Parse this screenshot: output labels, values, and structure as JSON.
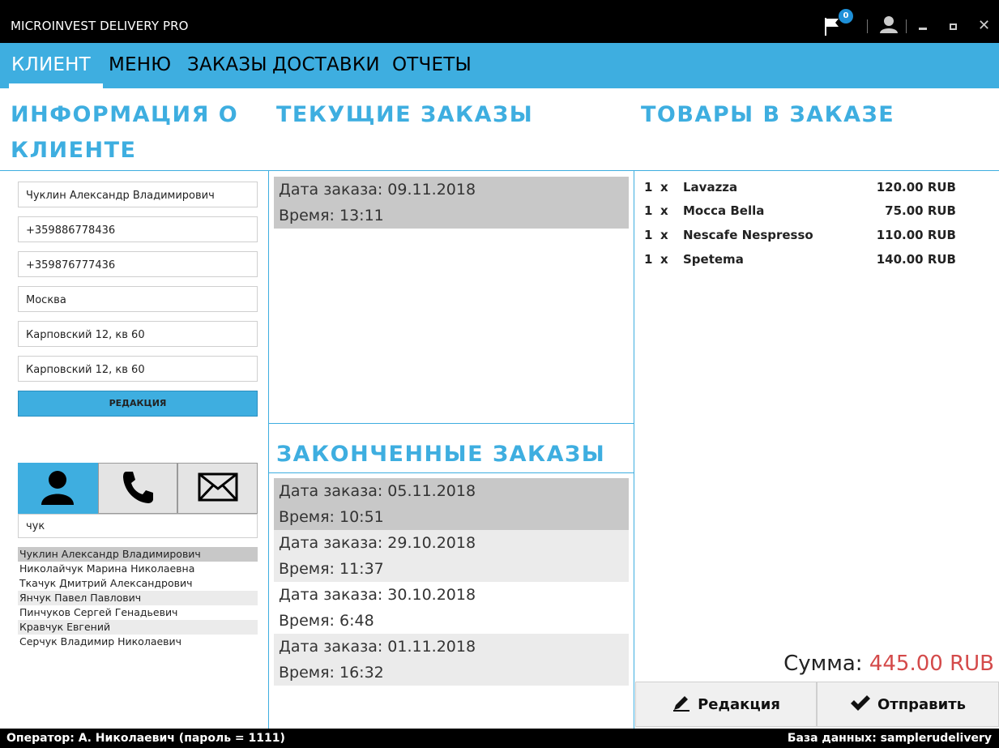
{
  "window": {
    "title": "MICROINVEST DELIVERY PRO",
    "notification_count": "0"
  },
  "menu": {
    "items": [
      "КЛИЕНТ",
      "МЕНЮ",
      "ЗАКАЗЫ",
      "ДОСТАВКИ",
      "ОТЧЕТЫ"
    ],
    "active": "КЛИЕНТ"
  },
  "sections": {
    "client_info_line1": "ИНФОРМАЦИЯ О",
    "client_info_line2": "КЛИЕНТЕ",
    "current_orders": "ТЕКУЩИЕ ЗАКАЗЫ",
    "order_goods": "ТОВАРЫ В ЗАКАЗЕ",
    "finished_orders": "ЗАКОНЧЕННЫЕ ЗАКАЗЫ"
  },
  "client": {
    "fields": [
      "Чуклин Александр Владимирович",
      "+359886778436",
      "+359876777436",
      "Москва",
      "Карповский 12, кв 60",
      "Карповский 12, кв 60"
    ],
    "edit_label": "РЕДАКЦИЯ",
    "search_value": "чук",
    "search_tabs": [
      "user-icon",
      "phone-icon",
      "envelope-icon"
    ],
    "search_results": [
      "Чуклин Александр Владимирович",
      "Николайчук Марина Николаевна",
      "Ткачук Дмитрий Александрович",
      "Янчук Павел Павлович",
      "Пинчуков Сергей Генадьевич",
      "Кравчук Евгений",
      "Серчук Владимир Николаевич"
    ]
  },
  "current_orders": [
    {
      "date": "Дата заказа: 09.11.2018",
      "time": "Время: 13:11"
    }
  ],
  "finished_orders": [
    {
      "date": "Дата заказа: 05.11.2018",
      "time": "Время: 10:51"
    },
    {
      "date": "Дата заказа: 29.10.2018",
      "time": "Время: 11:37"
    },
    {
      "date": "Дата заказа: 30.10.2018",
      "time": "Время: 6:48"
    },
    {
      "date": "Дата заказа: 01.11.2018",
      "time": "Время: 16:32"
    }
  ],
  "goods": [
    {
      "qty": "1",
      "x": "x",
      "name": "Lavazza",
      "price": "120.00 RUB"
    },
    {
      "qty": "1",
      "x": "x",
      "name": "Mocca Bella",
      "price": "75.00 RUB"
    },
    {
      "qty": "1",
      "x": "x",
      "name": "Nescafe Nespresso",
      "price": "110.00 RUB"
    },
    {
      "qty": "1",
      "x": "x",
      "name": "Spetema",
      "price": "140.00 RUB"
    }
  ],
  "total": {
    "label": "Сумма:",
    "amount": "445.00 RUB"
  },
  "buttons": {
    "edit": "Редакция",
    "send": "Отправить"
  },
  "status": {
    "operator": "Оператор: А. Николаевич (пароль = 1111)",
    "database": "База данных: samplerudelivery"
  },
  "colors": {
    "accent": "#3eaee0",
    "total_amount": "#d44a4a",
    "titlebar": "#000000"
  }
}
